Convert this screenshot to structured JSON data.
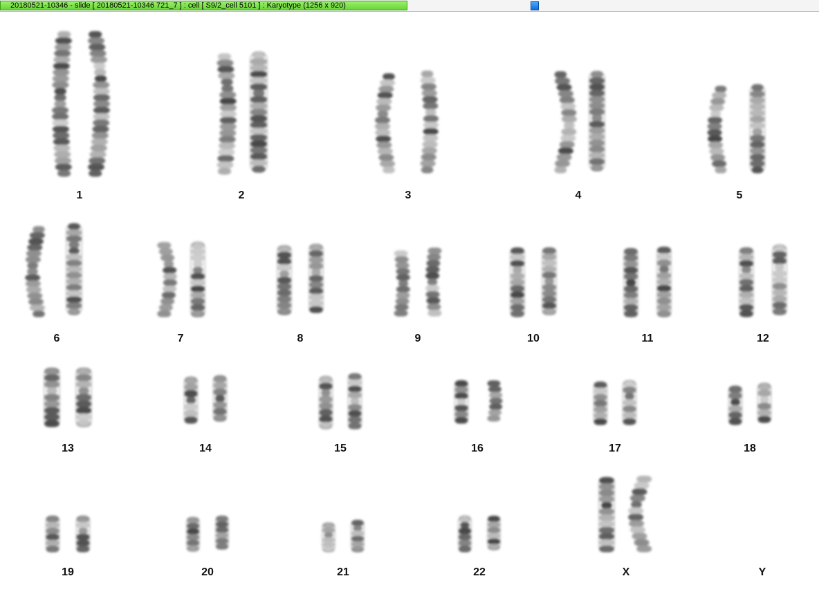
{
  "window": {
    "title": "20180521-10346 - slide [ 20180521-10346 721_7 ] : cell [ S9/2_cell 5101 ] : Karyotype  (1256 x 920)"
  },
  "karyotype": {
    "labels": [
      "1",
      "2",
      "3",
      "4",
      "5",
      "6",
      "7",
      "8",
      "9",
      "10",
      "11",
      "12",
      "13",
      "14",
      "15",
      "16",
      "17",
      "18",
      "19",
      "20",
      "21",
      "22",
      "X",
      "Y"
    ]
  }
}
